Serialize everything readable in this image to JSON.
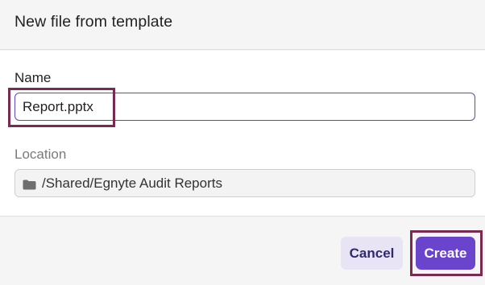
{
  "dialog": {
    "title": "New file from template"
  },
  "form": {
    "name_label": "Name",
    "name_value": "Report.pptx",
    "location_label": "Location",
    "location_value": "/Shared/Egnyte Audit Reports",
    "location_icon": "folder-icon"
  },
  "footer": {
    "cancel_label": "Cancel",
    "create_label": "Create"
  },
  "colors": {
    "accent": "#6a44cc",
    "focus_border": "#5b47c9",
    "cancel_bg": "#e8e4f5",
    "annotation_box": "#7a2a50"
  }
}
